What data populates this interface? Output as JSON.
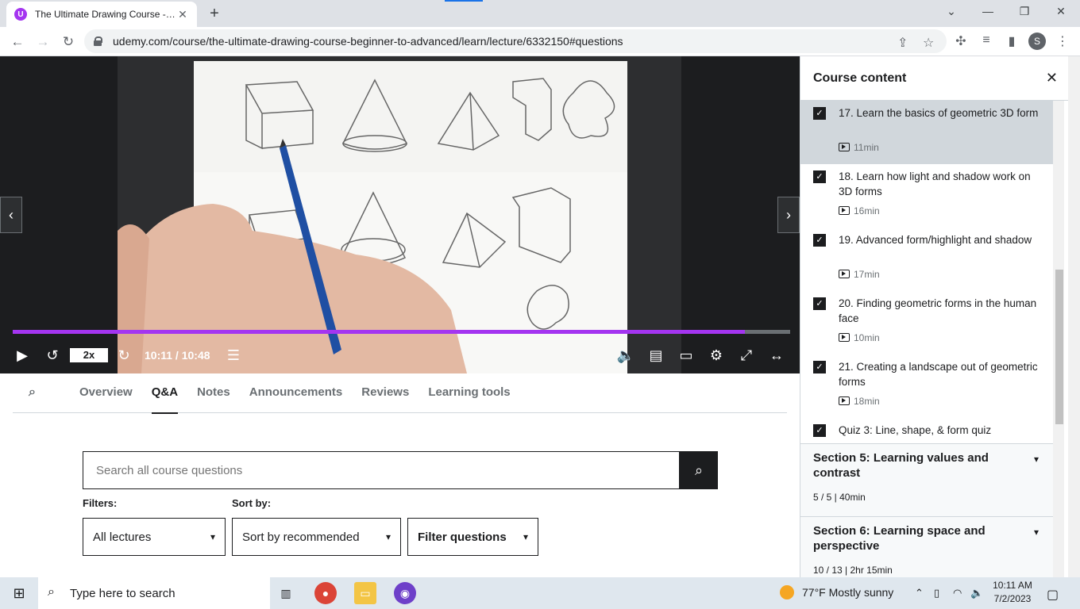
{
  "browser": {
    "tab_title": "The Ultimate Drawing Course - Beginner to Advanced",
    "tab_favicon": "udemy-icon",
    "new_tab": "+",
    "url": "udemy.com/course/the-ultimate-drawing-course-beginner-to-advanced/learn/lecture/6332150#questions",
    "profile_initial": "S"
  },
  "player": {
    "speed": "2x",
    "time": "10:11 / 10:48",
    "progress_fraction": 0.942,
    "progress_color": "#a435f0"
  },
  "course_tabs": [
    "Overview",
    "Q&A",
    "Notes",
    "Announcements",
    "Reviews",
    "Learning tools"
  ],
  "active_tab": "Q&A",
  "qa": {
    "search_placeholder": "Search all course questions",
    "filters_label": "Filters:",
    "sort_label": "Sort by:",
    "lectures_select": "All lectures",
    "sort_select": "Sort by recommended",
    "filter_questions": "Filter questions"
  },
  "sidebar": {
    "title": "Course content",
    "lectures": [
      {
        "title": "17. Learn the basics of geometric 3D form",
        "duration": "11min",
        "current": true
      },
      {
        "title": "18. Learn how light and shadow work on 3D forms",
        "duration": "16min"
      },
      {
        "title": "19. Advanced form/highlight and shadow",
        "duration": "17min"
      },
      {
        "title": "20. Finding geometric forms in the human face",
        "duration": "10min"
      },
      {
        "title": "21. Creating a landscape out of geometric forms",
        "duration": "18min"
      }
    ],
    "quiz": "Quiz 3: Line, shape, & form quiz",
    "sections": [
      {
        "title": "Section 5: Learning values and contrast",
        "summary": "5 / 5 | 40min"
      },
      {
        "title": "Section 6: Learning space and perspective",
        "summary": "10 / 13 | 2hr 15min"
      }
    ]
  },
  "taskbar": {
    "search_placeholder": "Type here to search",
    "weather": "77°F  Mostly sunny",
    "time": "10:11 AM",
    "date": "7/2/2023"
  }
}
